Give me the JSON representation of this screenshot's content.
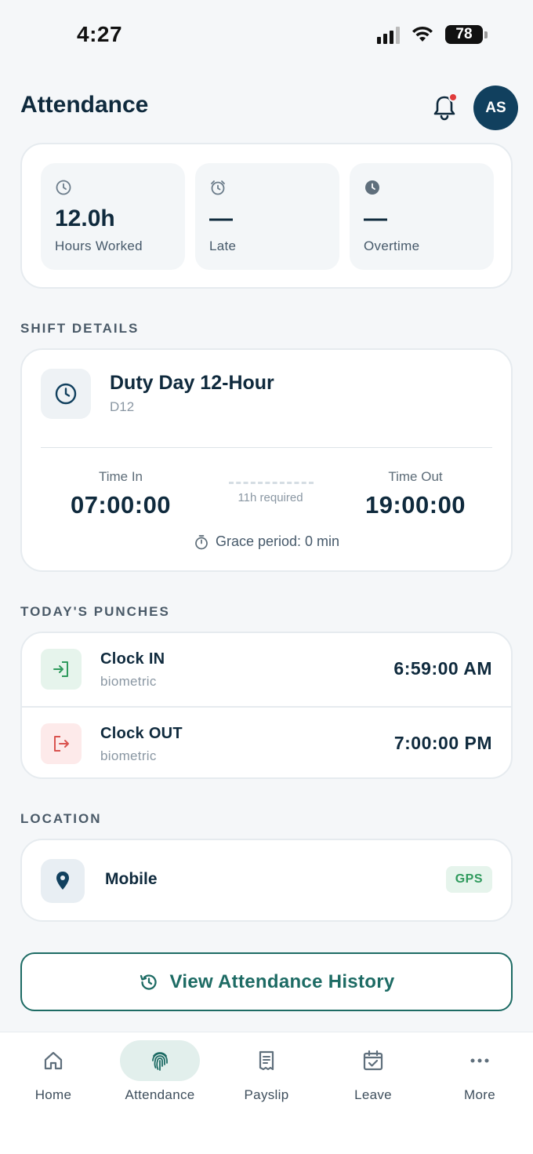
{
  "status_bar": {
    "time": "4:27",
    "battery": "78"
  },
  "header": {
    "title": "Attendance",
    "avatar_initials": "AS"
  },
  "summary": [
    {
      "value": "12.0h",
      "label": "Hours Worked",
      "icon": "clock-icon"
    },
    {
      "value": "—",
      "label": "Late",
      "icon": "alarm-icon"
    },
    {
      "value": "—",
      "label": "Overtime",
      "icon": "clock-filled-icon"
    }
  ],
  "shift": {
    "section_label": "SHIFT DETAILS",
    "name": "Duty Day 12-Hour",
    "code": "D12",
    "time_in_label": "Time In",
    "time_in": "07:00:00",
    "time_out_label": "Time Out",
    "time_out": "19:00:00",
    "required": "11h required",
    "grace": "Grace period: 0 min"
  },
  "punches": {
    "section_label": "TODAY'S PUNCHES",
    "items": [
      {
        "title": "Clock IN",
        "method": "biometric",
        "time": "6:59:00 AM",
        "color": "#2f9a5d",
        "bg": "#e6f4ec"
      },
      {
        "title": "Clock OUT",
        "method": "biometric",
        "time": "7:00:00 PM",
        "color": "#d9534f",
        "bg": "#fdeaea"
      }
    ]
  },
  "location": {
    "section_label": "LOCATION",
    "name": "Mobile",
    "badge": "GPS"
  },
  "history_button": {
    "label": "View Attendance History"
  },
  "nav": {
    "items": [
      {
        "label": "Home",
        "icon": "home-icon"
      },
      {
        "label": "Attendance",
        "icon": "fingerprint-icon",
        "active": true
      },
      {
        "label": "Payslip",
        "icon": "receipt-icon"
      },
      {
        "label": "Leave",
        "icon": "calendar-check-icon"
      },
      {
        "label": "More",
        "icon": "more-icon"
      }
    ]
  },
  "colors": {
    "primary": "#11405e",
    "accent": "#1d6b64",
    "background": "#f5f7f9"
  }
}
